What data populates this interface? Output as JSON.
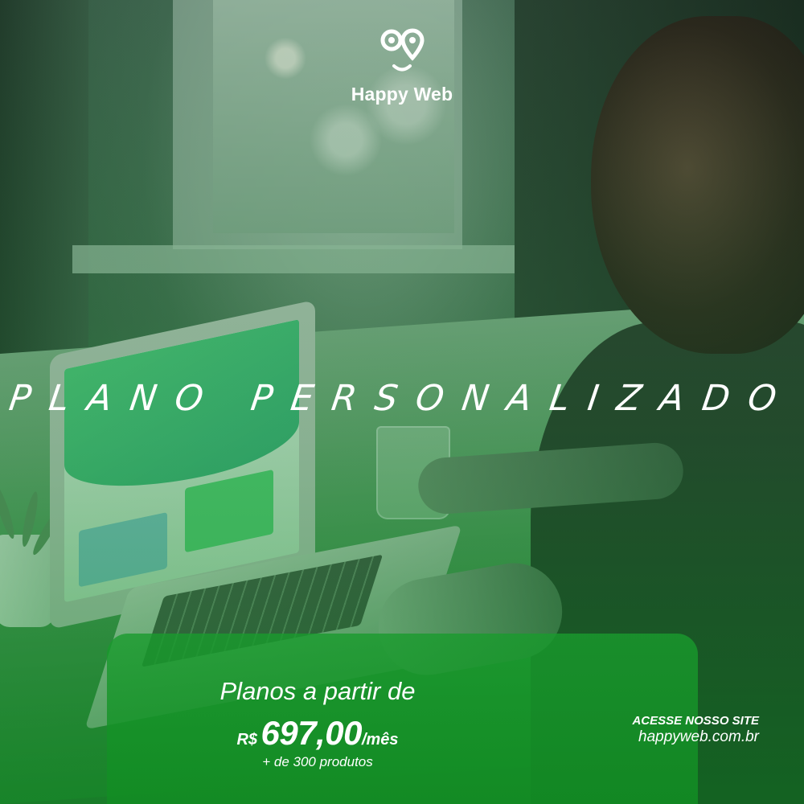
{
  "brand": {
    "name": "Happy Web",
    "logo_icon": "happy-web-eyes-pin-icon"
  },
  "headline": "PLANO PERSONALIZADO",
  "offer": {
    "intro": "Planos a partir de",
    "currency": "R$",
    "amount": "697,00",
    "period": "/mês",
    "products": "+ de 300 produtos"
  },
  "site": {
    "cta": "ACESSE NOSSO SITE",
    "url": "happyweb.com.br"
  },
  "colors": {
    "accent_green": "#1a9c2e",
    "text": "#ffffff"
  }
}
